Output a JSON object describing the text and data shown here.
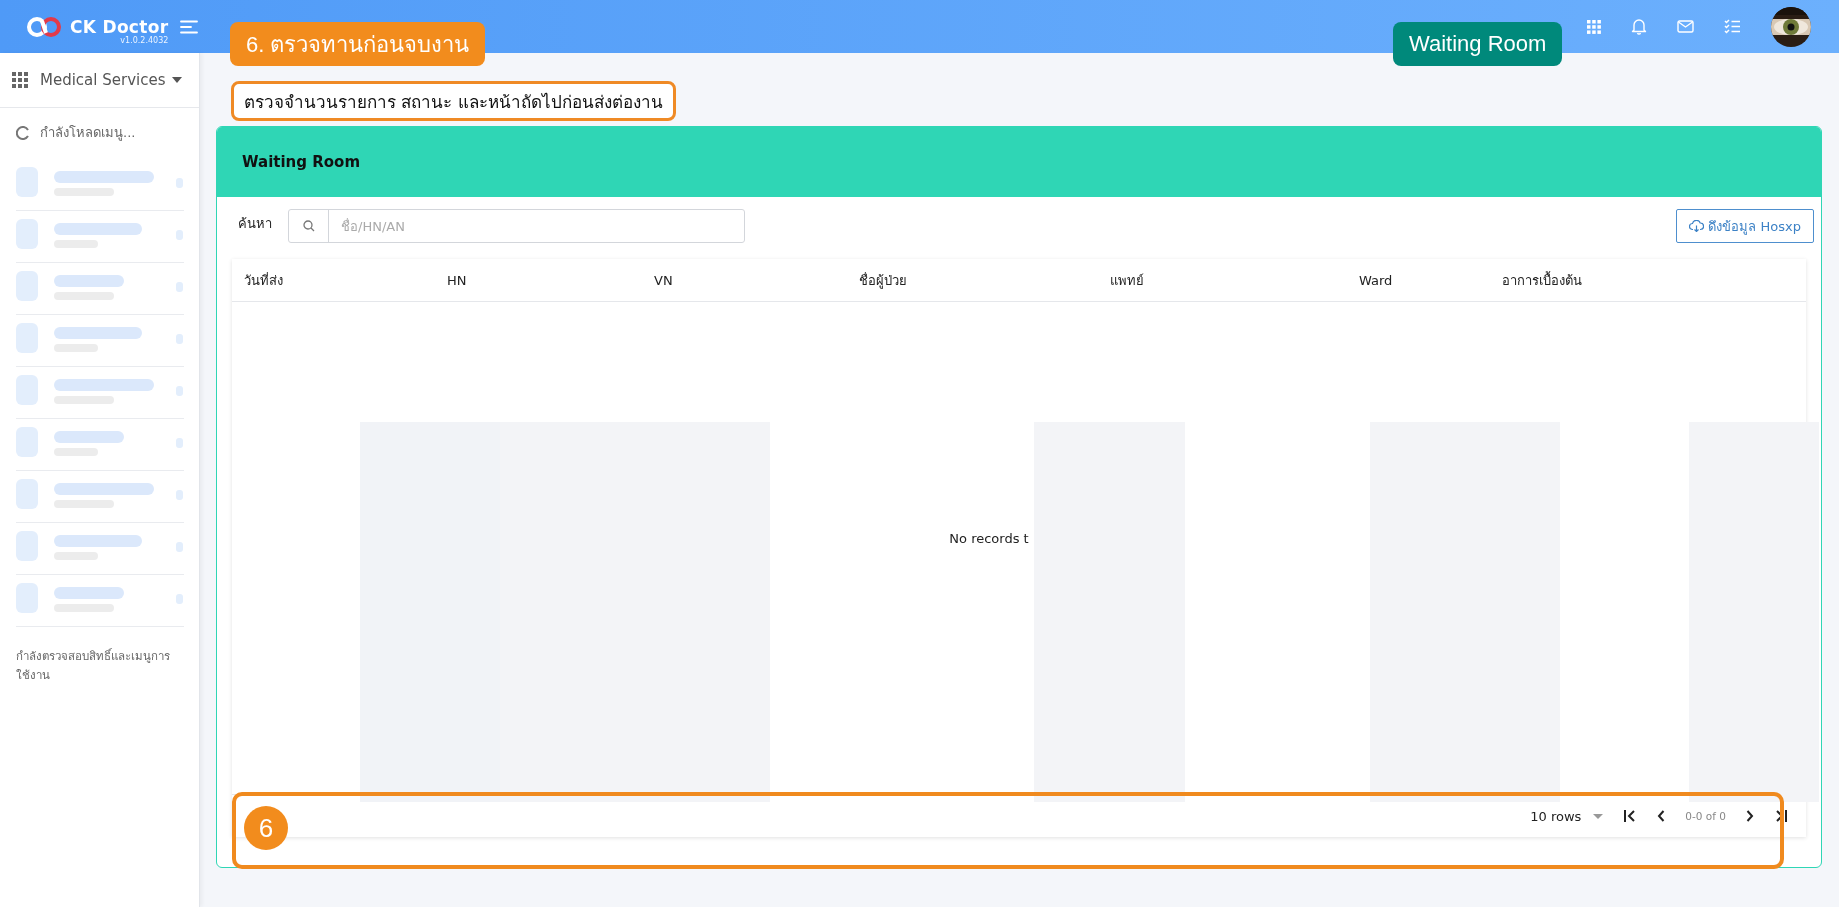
{
  "topbar": {
    "app_name": "CK Doctor",
    "version": "v1.0.2.4032"
  },
  "sidebar": {
    "menu_title": "Medical Services",
    "loading_text": "กำลังโหลดเมนู...",
    "status_text": "กำลังตรวจสอบสิทธิ์และเมนูการใช้งาน"
  },
  "card": {
    "title": "Waiting Room",
    "search": {
      "label": "ค้นหา",
      "placeholder": "ชื่อ/HN/AN"
    },
    "fetch_button": "ดึงข้อมูล Hosxp",
    "table": {
      "columns": [
        "วันที่ส่ง",
        "HN",
        "VN",
        "ชื่อผู้ป่วย",
        "แพทย์",
        "Ward",
        "อาการเบื้องต้น"
      ],
      "empty_text": "No records t"
    },
    "pagination": {
      "rows_per_page": "10 rows",
      "range": "0-0 of 0"
    }
  },
  "callouts": {
    "step_label": "6. ตรวจทานก่อนจบงาน",
    "page_badge": "Waiting Room",
    "instruction": "ตรวจจำนวนรายการ สถานะ และหน้าถัดไปก่อนส่งต่องาน",
    "marker": "6"
  }
}
